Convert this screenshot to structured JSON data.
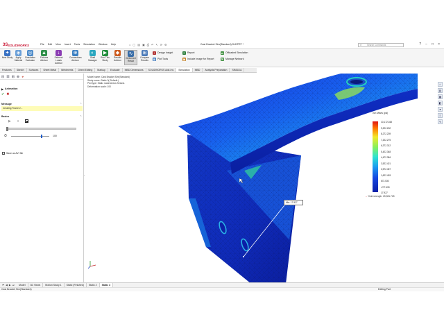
{
  "app": {
    "logo_text": "SOLIDWORKS",
    "menu": [
      "File",
      "Edit",
      "View",
      "Insert",
      "Tools",
      "Simulation",
      "Window",
      "Help"
    ],
    "document_title": "Cast Bracket Sim(Standard).SLDPRT *",
    "search_placeholder": "Search Commands"
  },
  "ribbon": {
    "large_buttons": [
      {
        "label": "New Study",
        "icon": "new-study-icon",
        "color": "#3a73c4"
      },
      {
        "label": "Apply Material",
        "icon": "apply-material-icon",
        "color": "#6a9fd8"
      },
      {
        "label": "Simulation Evaluator",
        "icon": "simulation-evaluator-icon",
        "color": "#4c8ac9"
      },
      {
        "label": "Fixtures Advisor",
        "icon": "fixtures-advisor-icon",
        "color": "#2f8f4a"
      },
      {
        "label": "External Loads Advisor",
        "icon": "external-loads-advisor-icon",
        "color": "#8b3db3"
      },
      {
        "label": "Connections Advisor",
        "icon": "connections-advisor-icon",
        "color": "#3b7fc2"
      },
      {
        "label": "Shell Manager",
        "icon": "shell-manager-icon",
        "color": "#2aa7c0"
      },
      {
        "label": "Run This Study",
        "icon": "run-study-icon",
        "color": "#1e8c3a"
      },
      {
        "label": "Results Advisor",
        "icon": "results-advisor-icon",
        "color": "#cc5a1e"
      },
      {
        "label": "Deformed Result",
        "icon": "deformed-result-icon",
        "color": "#3a6ea8"
      },
      {
        "label": "Compare Results",
        "icon": "compare-results-icon",
        "color": "#4a7ab8"
      }
    ],
    "small_buttons": [
      {
        "label": "Design Insight",
        "icon": "design-insight-icon",
        "color": "#b03030"
      },
      {
        "label": "Plot Tools",
        "icon": "plot-tools-icon",
        "color": "#2a6ab5"
      },
      {
        "label": "Report",
        "icon": "report-icon",
        "color": "#2f7f3f"
      },
      {
        "label": "Include Image for Report",
        "icon": "include-image-icon",
        "color": "#c07a1a"
      },
      {
        "label": "Offloaded Simulation",
        "icon": "offloaded-simulation-icon",
        "color": "#3f8f3f"
      },
      {
        "label": "Manage Network",
        "icon": "manage-network-icon",
        "color": "#3f8f3f"
      }
    ]
  },
  "command_tabs": [
    "Features",
    "Sketch",
    "Surfaces",
    "Sheet Metal",
    "Weldments",
    "Direct Editing",
    "Markup",
    "Evaluate",
    "MBD Dimensions",
    "SOLIDWORKS Add-Ins",
    "Simulation",
    "MBD",
    "Analysis Preparation",
    "SIMULIA"
  ],
  "command_tabs_active": "Simulation",
  "property_manager": {
    "title": "Animation",
    "message_header": "Message",
    "message": "Creating Frame 2...",
    "basics_header": "Basics",
    "frames_value": "100",
    "save_checkbox_label": "Save as AVI file"
  },
  "viewport": {
    "info": [
      "Model name: Cast Bracket Sim(Standard)",
      "Study name: Static 3(-Default-)",
      "Plot type: Static nodal stress Stress1",
      "Deformation scale: 100"
    ],
    "legend_title": "von Mises (psi)",
    "legend_ticks": [
      "10,172.168",
      "9,222.202",
      "8,272.239",
      "7,322.275",
      "6,372.312",
      "5,422.348",
      "4,472.384",
      "3,522.421",
      "2,572.457",
      "1,622.493",
      "672.530",
      "-277.433",
      "17.927"
    ],
    "yield_label": "Yield strength: 25,981.725",
    "probe_label": "Min: 17.927"
  },
  "bottom_tabs": [
    "Model",
    "3D Views",
    "Motion Study 1",
    "Static (Finished)",
    "Static 2",
    "Static 3"
  ],
  "bottom_tabs_active": "Static 3",
  "status": {
    "left": "Cast Bracket Sim(Standard)",
    "right": "Editing Part"
  }
}
